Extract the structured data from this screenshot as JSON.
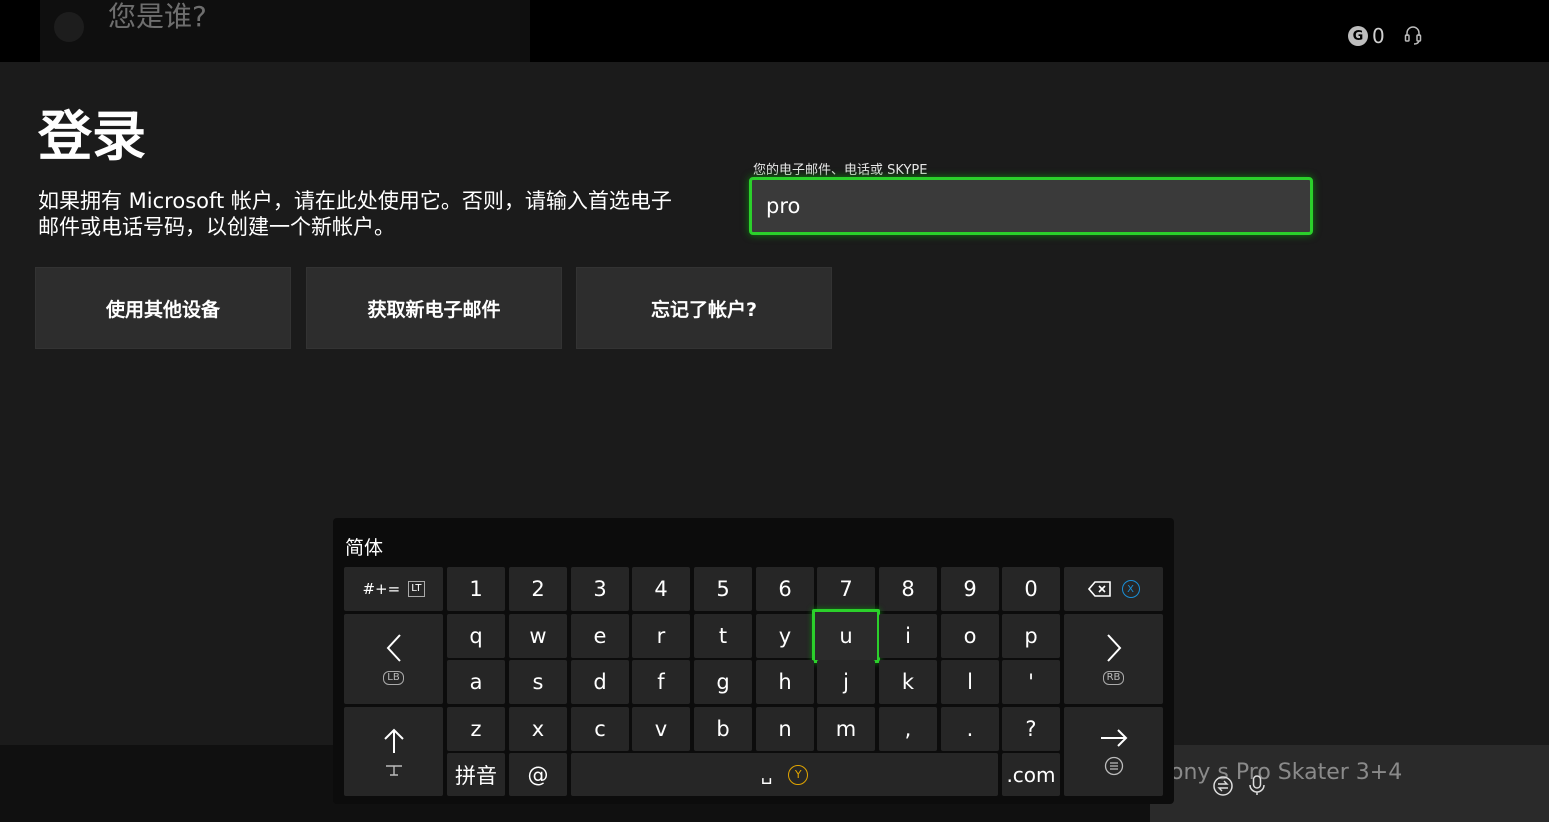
{
  "header": {
    "title": "您是谁?",
    "gamerscore_icon": "G",
    "gamerscore": "0"
  },
  "page": {
    "title": "登录",
    "description": "如果拥有 Microsoft 帐户，请在此处使用它。否则，请输入首选电子邮件或电话号码，以创建一个新帐户。"
  },
  "buttons": {
    "other_device": "使用其他设备",
    "new_email": "获取新电子邮件",
    "forgot": "忘记了帐户?"
  },
  "email": {
    "label": "您的电子邮件、电话或 SKYPE",
    "value": "pro"
  },
  "keyboard": {
    "language": "简体",
    "symbols_key": "#+=",
    "symbols_hint": "LT",
    "numbers": [
      "1",
      "2",
      "3",
      "4",
      "5",
      "6",
      "7",
      "8",
      "9",
      "0"
    ],
    "row1": [
      "q",
      "w",
      "e",
      "r",
      "t",
      "y",
      "u",
      "i",
      "o",
      "p"
    ],
    "row2": [
      "a",
      "s",
      "d",
      "f",
      "g",
      "h",
      "j",
      "k",
      "l",
      "'"
    ],
    "row3": [
      "z",
      "x",
      "c",
      "v",
      "b",
      "n",
      "m",
      ",",
      ".",
      "?"
    ],
    "pinyin": "拼音",
    "at": "@",
    "space": "␣",
    "space_hint": "Y",
    "dotcom": ".com",
    "backspace_hint": "X",
    "left_hint": "LB",
    "right_hint": "RB",
    "focused_key": "u"
  },
  "promo": {
    "text": "ony   s Pro Skater 3+4"
  }
}
